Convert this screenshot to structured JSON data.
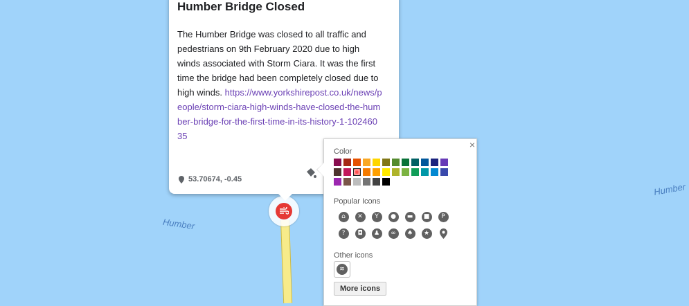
{
  "map": {
    "water_labels": [
      "Humber",
      "Humber"
    ]
  },
  "infocard": {
    "title": "Humber Bridge Closed",
    "description": "The Humber Bridge was closed to all traffic and pedestrians on 9th February 2020 due to high winds associated with Storm Ciara. It was the first time the bridge had been completely closed due to high winds.",
    "link": "https://www.yorkshirepost.co.uk/news/people/storm-ciara-high-winds-have-closed-the-humber-bridge-for-the-first-time-in-its-history-1-10246035",
    "coordinates": "53.70674, -0.45"
  },
  "style_panel": {
    "close": "×",
    "color_title": "Color",
    "popular_icons_title": "Popular Icons",
    "other_icons_title": "Other icons",
    "more_icons_label": "More icons",
    "colors": [
      "#880e4f",
      "#a52714",
      "#e65100",
      "#f9a825",
      "#ffd600",
      "#817717",
      "#558b2f",
      "#097138",
      "#006064",
      "#01579b",
      "#1a237e",
      "#673ab7",
      "#4e342e",
      "#c2185b",
      "#ff5252",
      "#f57c00",
      "#ffa000",
      "#ffea00",
      "#afb42b",
      "#7cb342",
      "#0f9d58",
      "#0097a7",
      "#0288d1",
      "#3949ab",
      "#9c27b0",
      "#795548",
      "#bdbdbd",
      "#757575",
      "#424242",
      "#000000"
    ],
    "selected_color": "#ff5252",
    "popular_icons": [
      "home-icon",
      "restaurant-icon",
      "bar-icon",
      "chat-icon",
      "hotel-icon",
      "shopping-icon",
      "parking-icon",
      "help-icon",
      "camera-icon",
      "hiking-icon",
      "cycling-icon",
      "running-icon",
      "star-icon",
      "place-icon"
    ]
  }
}
